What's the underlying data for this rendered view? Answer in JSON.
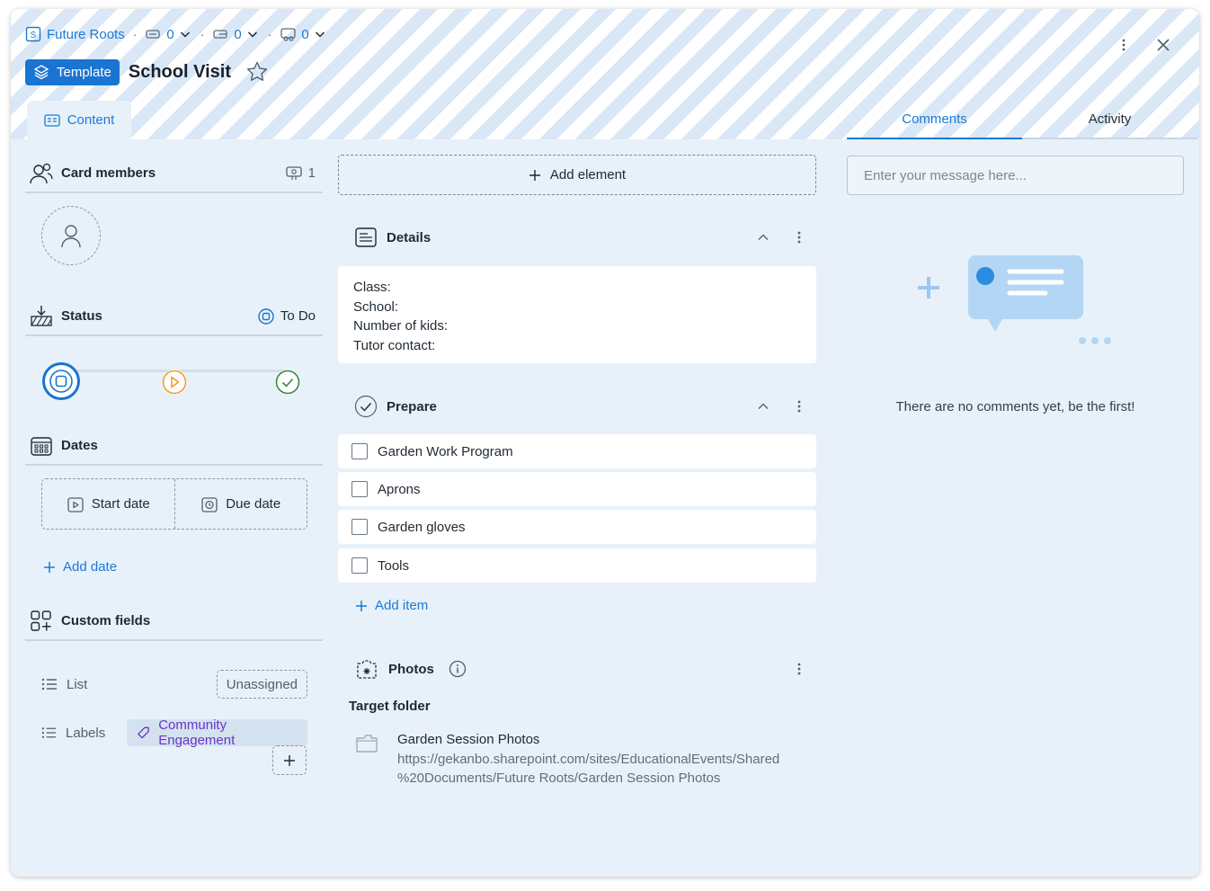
{
  "header": {
    "workspace": "Future Roots",
    "counters": [
      "0",
      "0",
      "0"
    ],
    "template_badge": "Template",
    "title": "School Visit"
  },
  "tabs": {
    "content": "Content",
    "comments": "Comments",
    "activity": "Activity"
  },
  "members": {
    "label": "Card members",
    "count": "1"
  },
  "status": {
    "label": "Status",
    "current": "To Do"
  },
  "dates": {
    "label": "Dates",
    "start": "Start date",
    "due": "Due date",
    "add": "Add date"
  },
  "custom_fields": {
    "label": "Custom fields",
    "list_label": "List",
    "list_value": "Unassigned",
    "labels_label": "Labels",
    "labels_value": "Community Engagement"
  },
  "add_element": "Add element",
  "details": {
    "label": "Details",
    "lines": [
      "Class:",
      "School:",
      "Number of kids:",
      "Tutor contact:"
    ]
  },
  "prepare": {
    "label": "Prepare",
    "items": [
      "Garden Work Program",
      "Aprons",
      "Garden gloves",
      "Tools"
    ],
    "add": "Add item"
  },
  "photos": {
    "label": "Photos",
    "target_label": "Target folder",
    "folder_name": "Garden Session Photos",
    "folder_url_1": "https://gekanbo.sharepoint.com/sites/EducationalEvents/Shared",
    "folder_url_2": "%20Documents/Future Roots/Garden Session Photos"
  },
  "comments": {
    "placeholder": "Enter your message here...",
    "empty": "There are no comments yet, be the first!"
  },
  "colors": {
    "accent": "#1a7ad4",
    "todo": "#1a74d1",
    "in_progress": "#f59b23",
    "done": "#2f8a3e",
    "label": "#6a35c8"
  }
}
